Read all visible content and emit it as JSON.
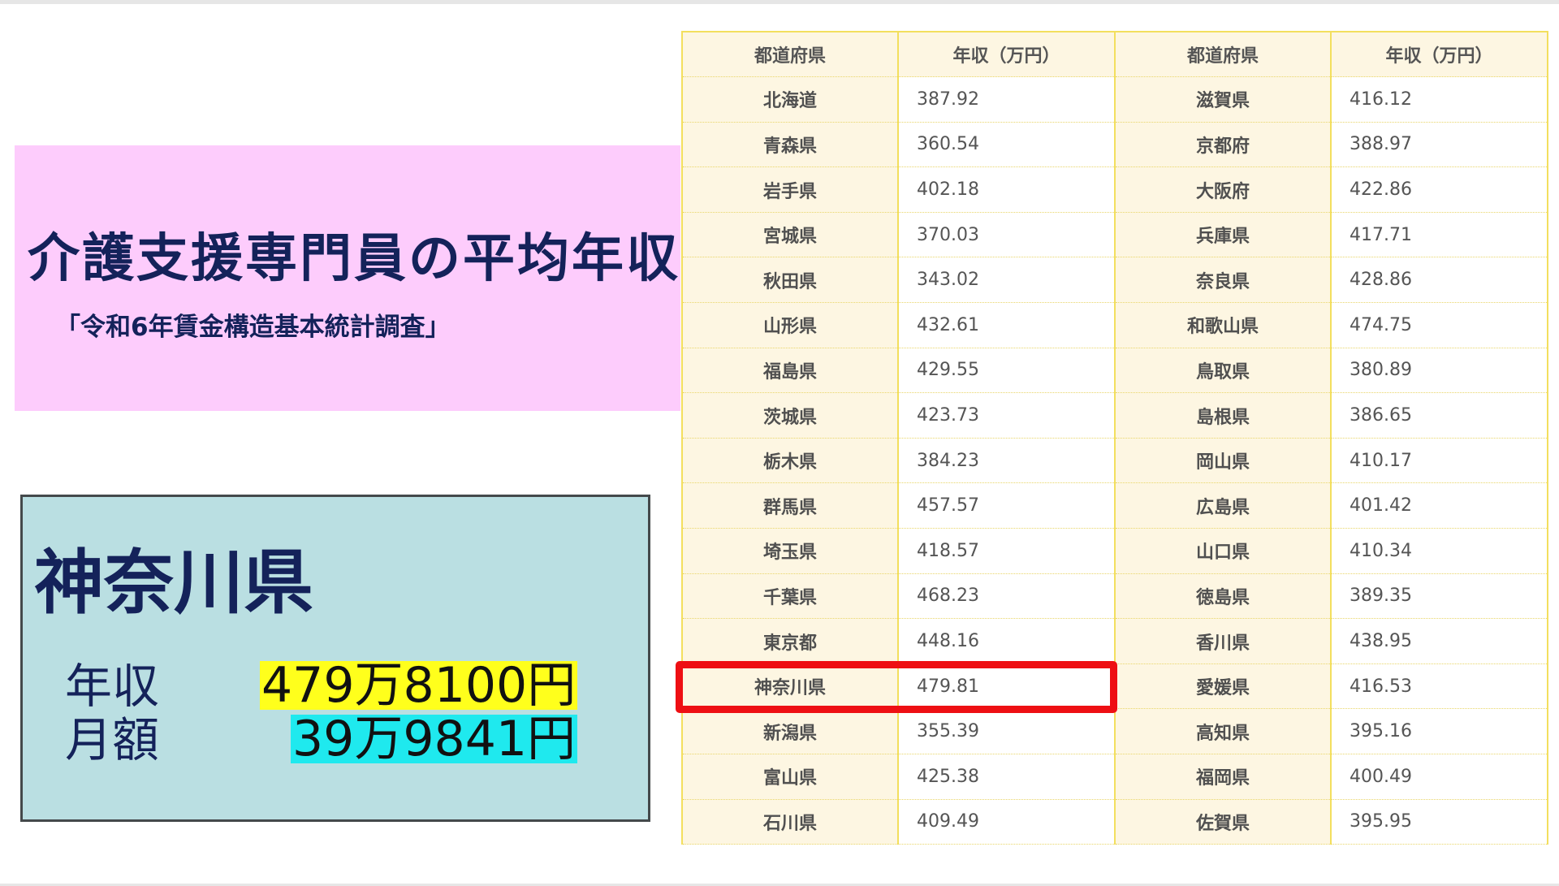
{
  "title_panel": {
    "title": "介護支援専門員の平均年収",
    "source": "「令和6年賃金構造基本統計調査」"
  },
  "info_panel": {
    "prefecture": "神奈川県",
    "annual_label": "年収",
    "annual_value": "479万8100円",
    "monthly_label": "月額",
    "monthly_value": "39万9841円"
  },
  "table": {
    "headers": [
      "都道府県",
      "年収（万円）",
      "都道府県",
      "年収（万円）"
    ],
    "rows": [
      [
        "北海道",
        "387.92",
        "滋賀県",
        "416.12"
      ],
      [
        "青森県",
        "360.54",
        "京都府",
        "388.97"
      ],
      [
        "岩手県",
        "402.18",
        "大阪府",
        "422.86"
      ],
      [
        "宮城県",
        "370.03",
        "兵庫県",
        "417.71"
      ],
      [
        "秋田県",
        "343.02",
        "奈良県",
        "428.86"
      ],
      [
        "山形県",
        "432.61",
        "和歌山県",
        "474.75"
      ],
      [
        "福島県",
        "429.55",
        "鳥取県",
        "380.89"
      ],
      [
        "茨城県",
        "423.73",
        "島根県",
        "386.65"
      ],
      [
        "栃木県",
        "384.23",
        "岡山県",
        "410.17"
      ],
      [
        "群馬県",
        "457.57",
        "広島県",
        "401.42"
      ],
      [
        "埼玉県",
        "418.57",
        "山口県",
        "410.34"
      ],
      [
        "千葉県",
        "468.23",
        "徳島県",
        "389.35"
      ],
      [
        "東京都",
        "448.16",
        "香川県",
        "438.95"
      ],
      [
        "神奈川県",
        "479.81",
        "愛媛県",
        "416.53"
      ],
      [
        "新潟県",
        "355.39",
        "高知県",
        "395.16"
      ],
      [
        "富山県",
        "425.38",
        "福岡県",
        "400.49"
      ],
      [
        "石川県",
        "409.49",
        "佐賀県",
        "395.95"
      ]
    ],
    "highlighted_row": 13
  },
  "colors": {
    "title_panel_bg": "#fdccfc",
    "info_panel_bg": "#badfe2",
    "annual_highlight": "#ffff1c",
    "monthly_highlight": "#1fe9ee",
    "highlight_border": "#ee0f13",
    "table_border": "#f3df5e",
    "table_header_bg": "#fdf6e2",
    "text_navy": "#14225a"
  }
}
